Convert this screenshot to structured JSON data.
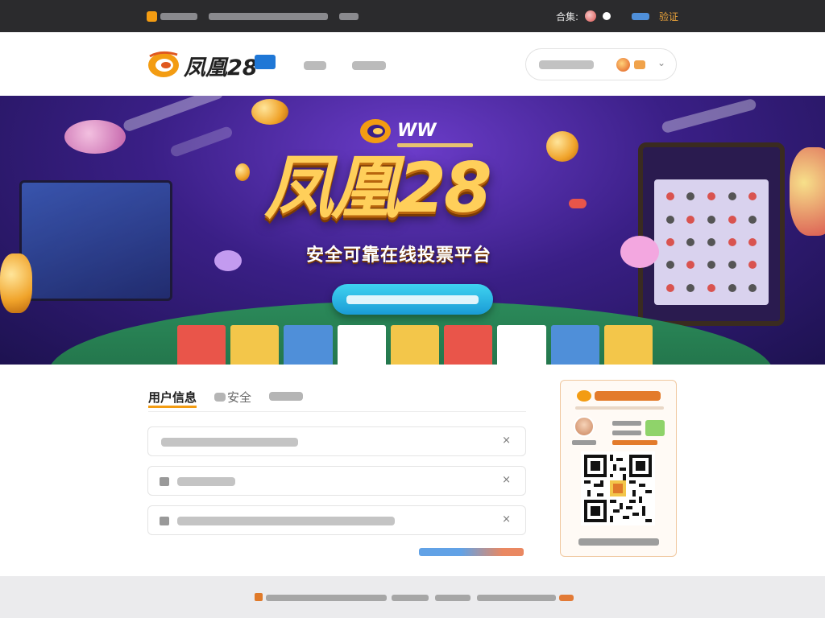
{
  "topbar": {
    "right_label": "合集:",
    "right_link": "验证"
  },
  "header": {
    "logo_text": "凤凰28"
  },
  "hero": {
    "brand_text": "WW",
    "title": "凤凰28",
    "subtitle": "安全可靠在线投票平台"
  },
  "content": {
    "tabs": [
      {
        "label": "用户信息",
        "active": true
      },
      {
        "label": "安全",
        "active": false
      }
    ],
    "rows": [
      {
        "close_icon": "×"
      },
      {
        "close_icon": "×"
      },
      {
        "close_icon": "×"
      }
    ]
  },
  "colors": {
    "accent": "#f39c12",
    "topbar": "#2b2b2d",
    "hero_bg": "#3a1f86",
    "hero_button": "#1a9bd6",
    "link_blue": "#3a8be0"
  }
}
